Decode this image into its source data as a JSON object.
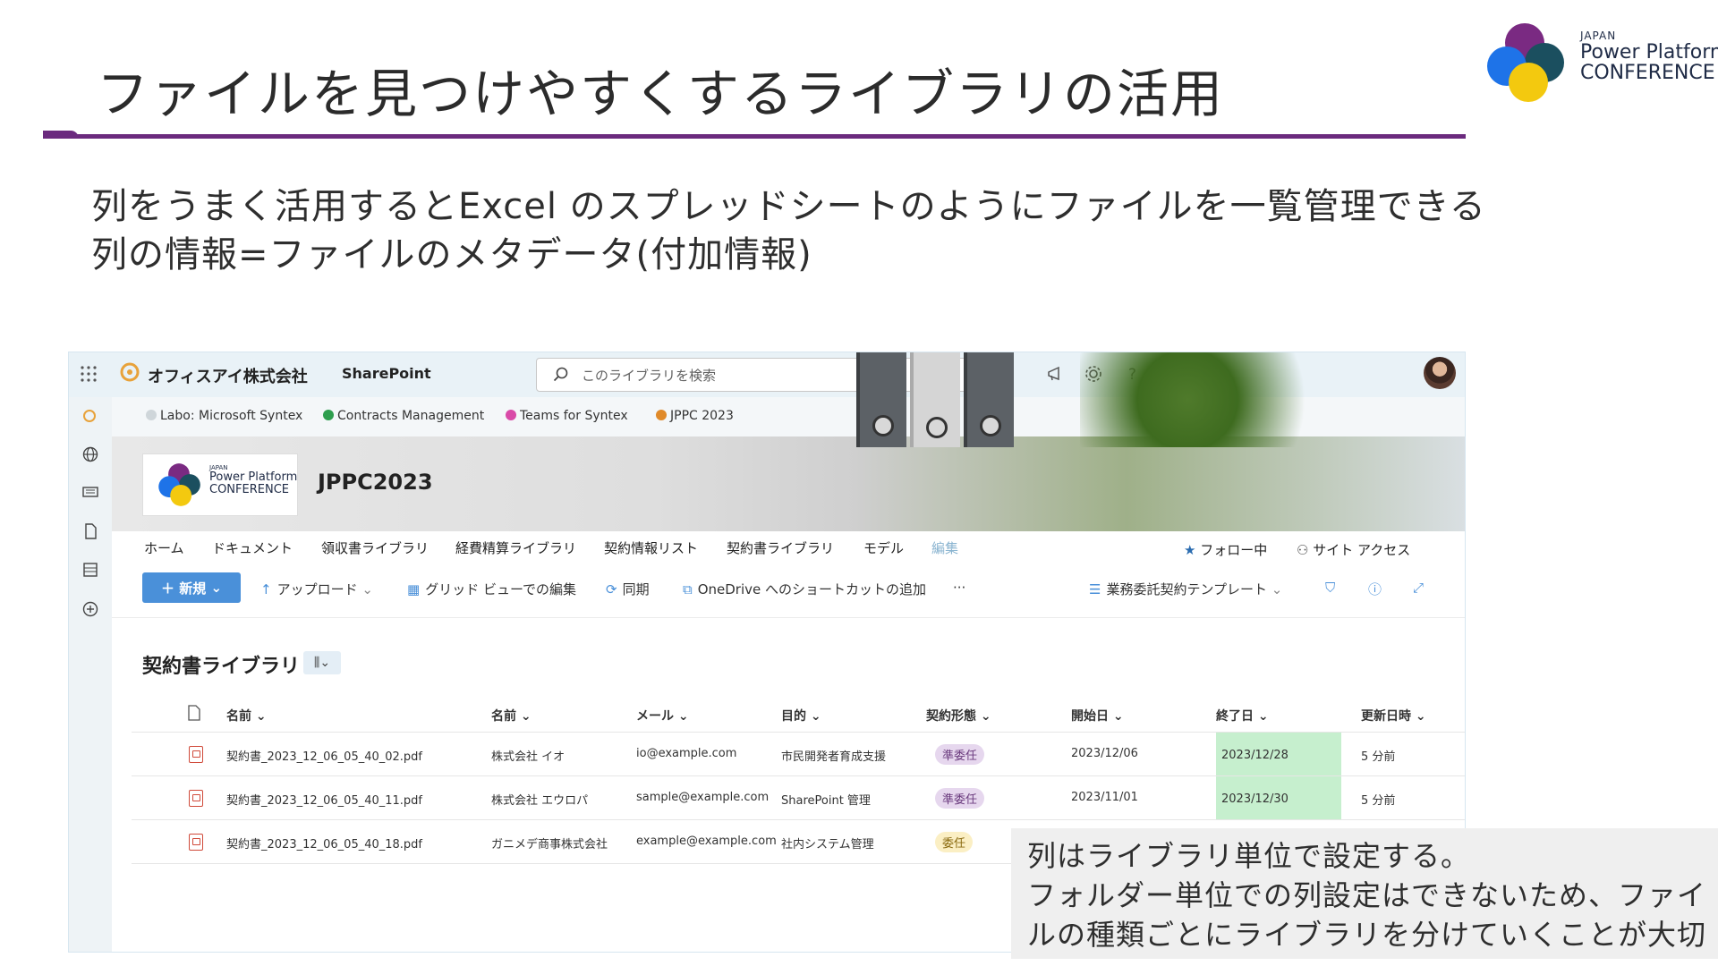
{
  "slide": {
    "title": "ファイルを見つけやすくするライブラリの活用",
    "bullets": [
      "列をうまく活用するとExcel のスプレッドシートのようにファイルを一覧管理できる",
      "列の情報=ファイルのメタデータ(付加情報)"
    ],
    "brand": {
      "japan": "JAPAN",
      "line1": "Power Platform",
      "line2": "CONFERENCE"
    },
    "note": {
      "lines": [
        "列はライブラリ単位で設定する。",
        "フォルダー単位での列設定はできないため、ファイ",
        "ルの種類ごとにライブラリを分けていくことが大切"
      ]
    },
    "accent_color": "#6b2a7e"
  },
  "sharepoint": {
    "org_name": "オフィスアイ株式会社",
    "app_name": "SharePoint",
    "search_placeholder": "このライブラリを検索",
    "hub_links": [
      "Labo: Microsoft Syntex",
      "Contracts Management",
      "Teams for Syntex",
      "JPPC 2023"
    ],
    "site": {
      "title": "JPPC2023",
      "logo": {
        "japan": "JAPAN",
        "line1": "Power Platform",
        "line2": "CONFERENCE"
      }
    },
    "nav": [
      "ホーム",
      "ドキュメント",
      "領収書ライブラリ",
      "経費精算ライブラリ",
      "契約情報リスト",
      "契約書ライブラリ",
      "モデル",
      "編集"
    ],
    "nav_right": {
      "follow": "フォロー中",
      "site_access": "サイト アクセス"
    },
    "commands": {
      "new": "新規",
      "upload": "アップロード",
      "grid_edit": "グリッド ビューでの編集",
      "sync": "同期",
      "onedrive_shortcut": "OneDrive へのショートカットの追加",
      "more": "···",
      "view": "業務委託契約テンプレート"
    },
    "library": {
      "title": "契約書ライブラリ",
      "columns": [
        "名前",
        "名前",
        "メール",
        "目的",
        "契約形態",
        "開始日",
        "終了日",
        "更新日時"
      ],
      "rows": [
        {
          "file": "契約書_2023_12_06_05_40_02.pdf",
          "company": "株式会社 イオ",
          "email": "io@example.com",
          "purpose": "市民開発者育成支援",
          "type": "準委任",
          "start": "2023/12/06",
          "end": "2023/12/28",
          "modified": "5 分前"
        },
        {
          "file": "契約書_2023_12_06_05_40_11.pdf",
          "company": "株式会社 エウロパ",
          "email": "sample@example.com",
          "purpose": "SharePoint 管理",
          "type": "準委任",
          "start": "2023/11/01",
          "end": "2023/12/30",
          "modified": "5 分前"
        },
        {
          "file": "契約書_2023_12_06_05_40_18.pdf",
          "company": "ガニメデ商事株式会社",
          "email": "example@example.com",
          "purpose": "社内システム管理",
          "type": "委任",
          "start": "",
          "end": "",
          "modified": ""
        }
      ]
    }
  }
}
